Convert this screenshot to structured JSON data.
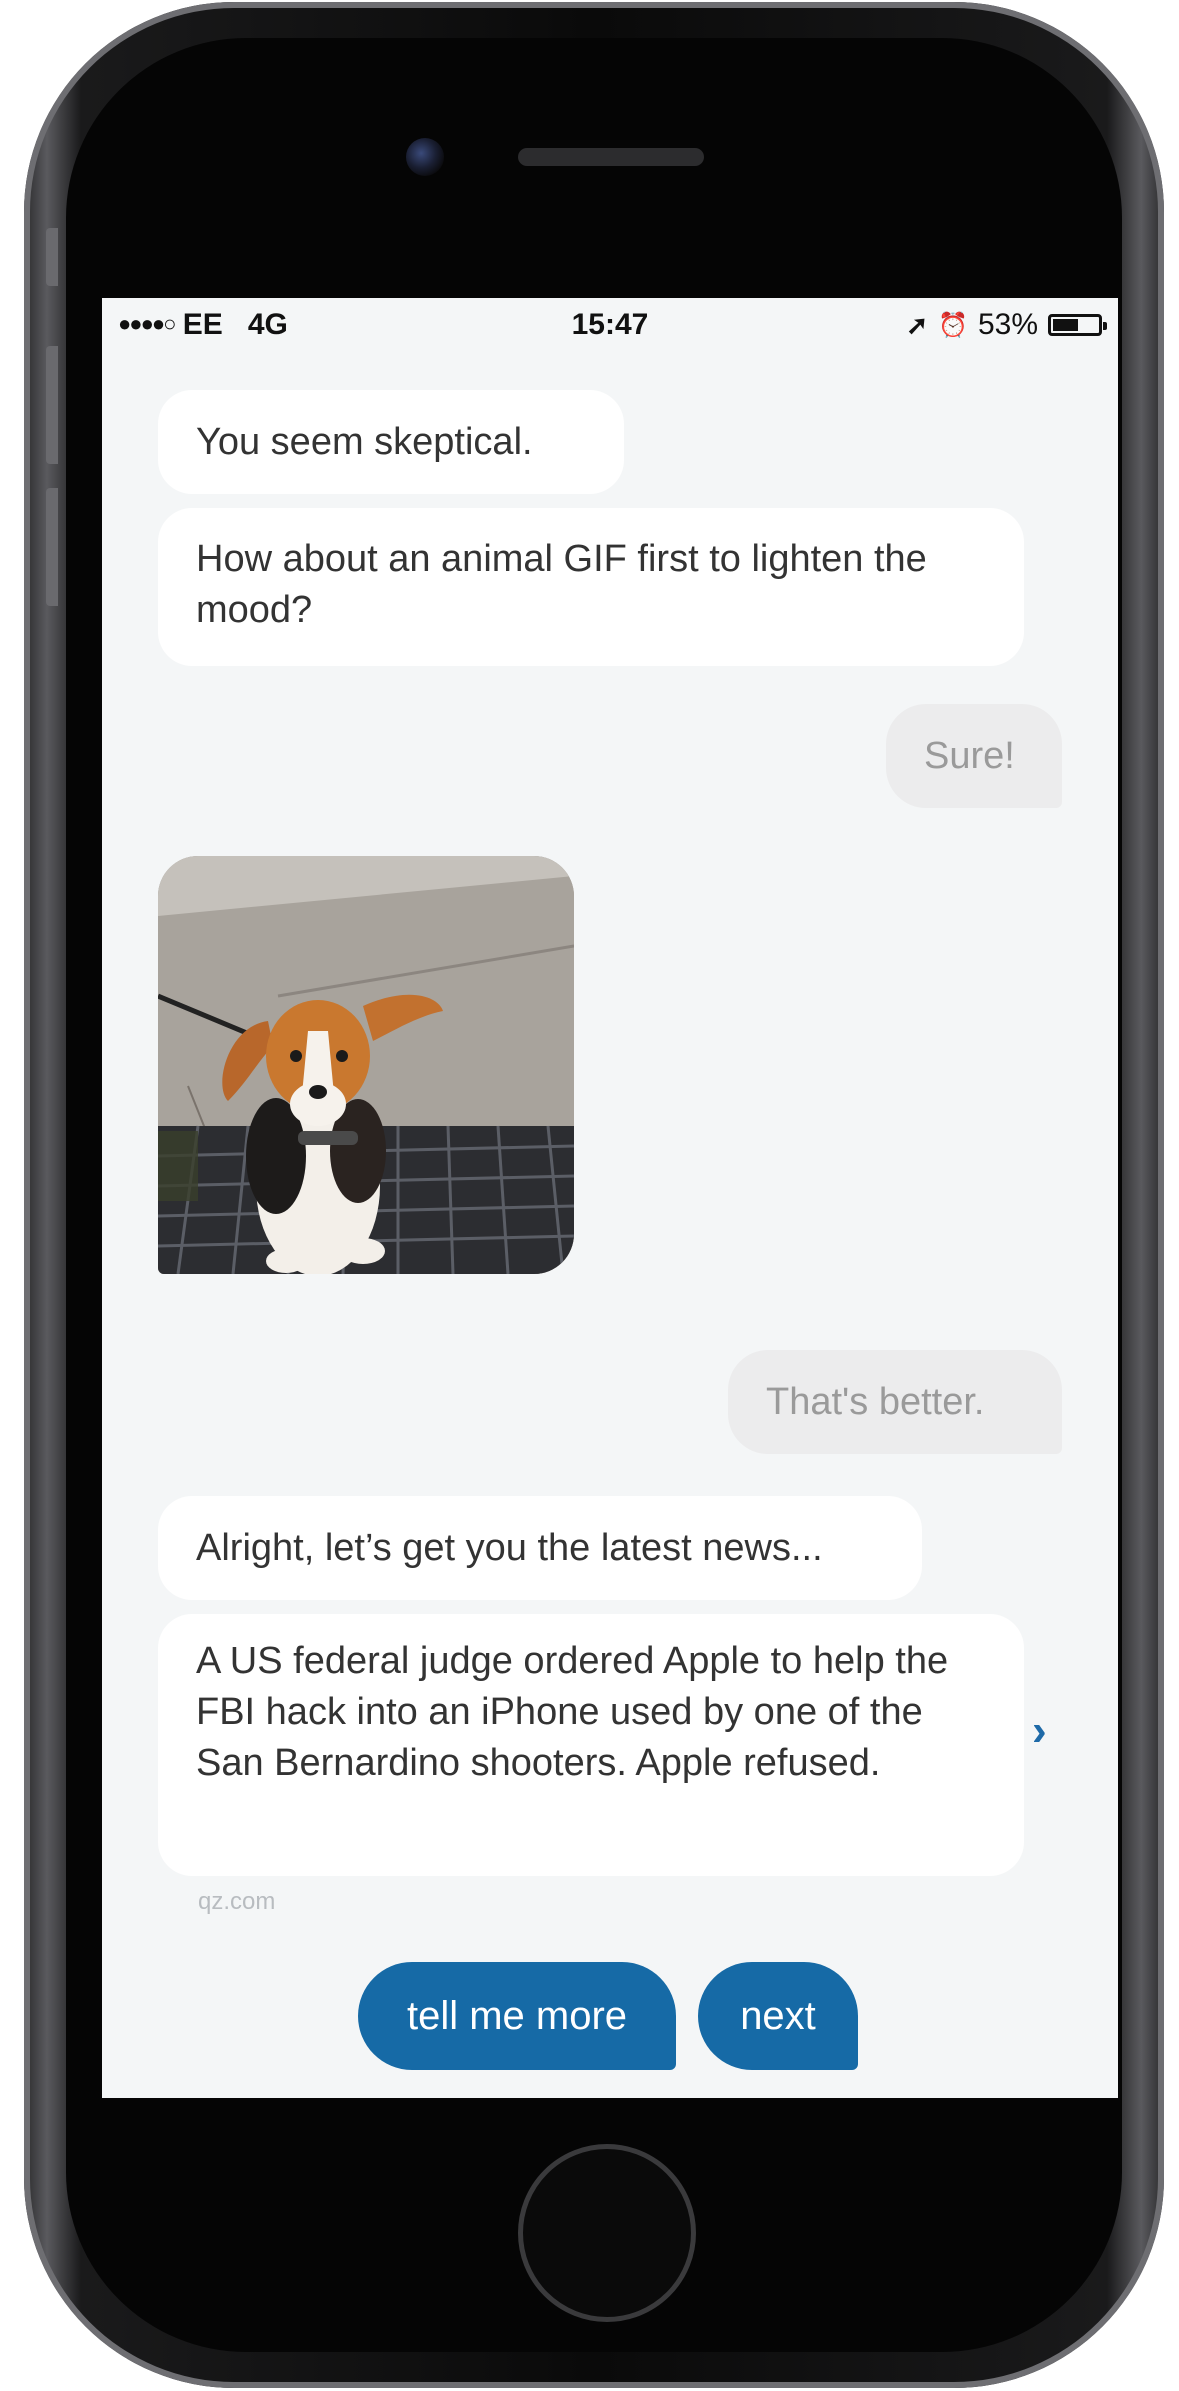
{
  "status_bar": {
    "signal": "●●●●○",
    "carrier": "EE",
    "network": "4G",
    "time": "15:47",
    "location_icon": "➚",
    "alarm_icon": "⏰",
    "battery_pct": "53%",
    "battery_level": 0.53
  },
  "messages": [
    {
      "from": "bot",
      "text": "You seem skeptical."
    },
    {
      "from": "bot",
      "text": "How about an animal GIF first to lighten the mood?"
    },
    {
      "from": "user",
      "text": "Sure!"
    },
    {
      "from": "bot",
      "type": "gif",
      "subject": "beagle puppy with ears blowing in wind"
    },
    {
      "from": "user",
      "text": "That's better."
    },
    {
      "from": "bot",
      "text": "Alright, let’s get you the latest news..."
    },
    {
      "from": "bot",
      "text": "A US federal judge ordered Apple to help the FBI hack into an iPhone used by one of the San Bernardino shooters. Apple refused.",
      "source": "qz.com"
    }
  ],
  "news_chevron": "›",
  "actions": {
    "tell_me_more": "tell me more",
    "next": "next"
  },
  "colors": {
    "accent": "#166aa6",
    "screen_bg": "#f4f6f7",
    "user_bubble": "#ececed"
  }
}
